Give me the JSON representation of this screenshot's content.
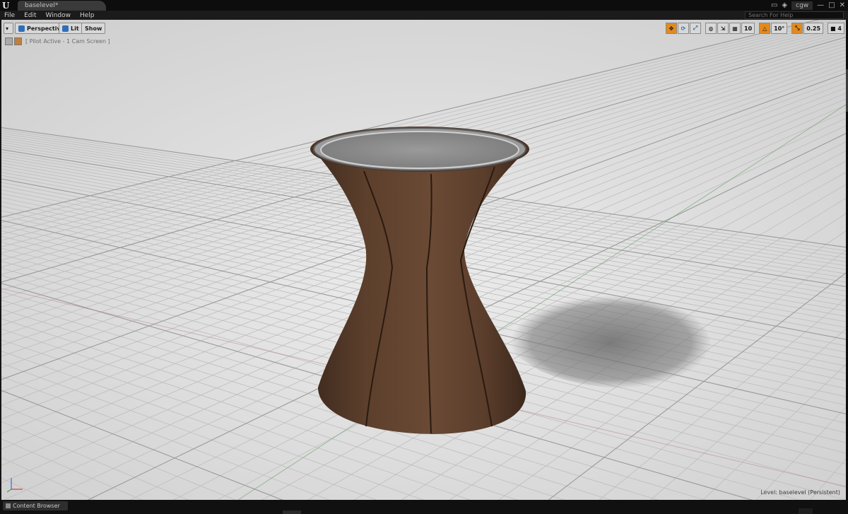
{
  "window": {
    "doc_tab": "baselevel*",
    "user": "cgw",
    "search_placeholder": "Search For Help"
  },
  "menu": [
    "File",
    "Edit",
    "Window",
    "Help"
  ],
  "viewport": {
    "view_mode": "Perspective",
    "lighting": "Lit",
    "show": "Show",
    "pilot_status": "[ Pilot Active - 1 Cam Screen ]",
    "grid_snap": "10",
    "rotation_snap": "10°",
    "scale_snap": "0.25",
    "camera_speed": "4",
    "level_label": "Level:",
    "level_name": "baselevel (Persistent)"
  },
  "bottom": {
    "content_browser": "Content Browser"
  },
  "colors": {
    "floor": "#e2e2e2",
    "grid": "#a4a4a4",
    "stool_leather": "#5a3d2b",
    "stool_top": "#8e8e8e",
    "accent_orange": "#e38a1c",
    "accent_blue": "#2f6fb8"
  }
}
